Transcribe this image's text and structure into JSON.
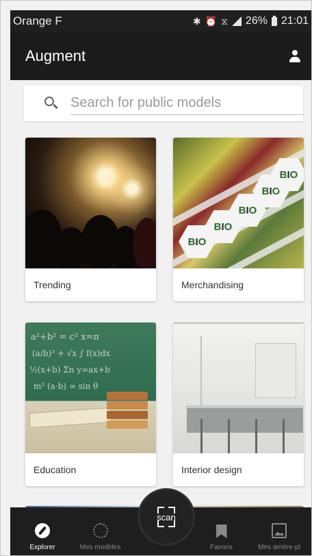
{
  "status_bar": {
    "carrier": "Orange F",
    "battery": "26%",
    "time": "21:01"
  },
  "app_bar": {
    "title": "Augment",
    "account_icon": "account-icon"
  },
  "search": {
    "placeholder": "Search for public models",
    "value": ""
  },
  "categories": [
    {
      "label": "Trending",
      "image": "fireworks-crowd"
    },
    {
      "label": "Merchandising",
      "image": "bio-shelves"
    },
    {
      "label": "Education",
      "image": "chalkboard-books"
    },
    {
      "label": "Interior design",
      "image": "kitchen-interior"
    }
  ],
  "bottom_nav": {
    "items": [
      {
        "label": "Explorer",
        "icon": "compass-icon",
        "active": true
      },
      {
        "label": "Mes modèles",
        "icon": "globe-icon",
        "active": false
      },
      {
        "label": "Favoris",
        "icon": "bookmark-icon",
        "active": false
      },
      {
        "label": "Mes arrière-pl",
        "icon": "image-icon",
        "active": false
      }
    ],
    "scan_label": "scan"
  },
  "colors": {
    "app_bar": "#1b1b1b",
    "background": "#f1f1f1",
    "nav_active": "#ffffff",
    "nav_inactive": "#8a8a8a"
  }
}
